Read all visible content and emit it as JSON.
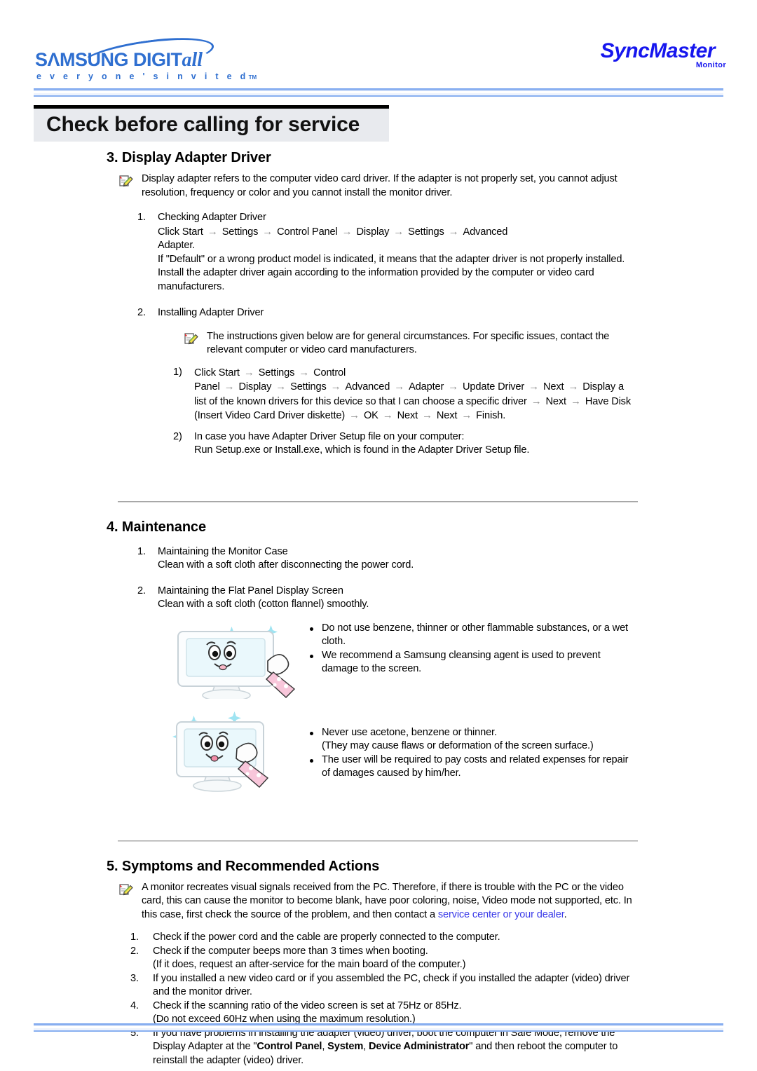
{
  "header": {
    "samsung_logo": {
      "wordmark_main": "SΛMSUNG DIGIT",
      "wordmark_italic": "all",
      "tagline": "e v e r y o n e ' s   i n v i t e d",
      "tagline_tm": "TM"
    },
    "syncmaster_logo": {
      "word": "SyncMaster",
      "sub": "Monitor"
    }
  },
  "title_banner": {
    "title": "Check before calling for service"
  },
  "section3": {
    "heading": "3. Display Adapter Driver",
    "note": "Display adapter refers to the computer video card driver. If the adapter is not properly set, you cannot adjust resolution, frequency or color and you cannot install the monitor driver.",
    "items": [
      {
        "num": "1.",
        "title": "Checking Adapter Driver",
        "path_segments": [
          "Click Start",
          "Settings",
          "Control Panel",
          "Display",
          "Settings",
          "Advanced"
        ],
        "path_tail": "Adapter.",
        "body": "If \"Default\" or a wrong product model is indicated, it means that the adapter driver is not properly installed. Install the adapter driver again according to the information provided by the computer or video card manufacturers."
      },
      {
        "num": "2.",
        "title": "Installing Adapter Driver",
        "note": "The instructions given below are for general circumstances. For specific issues, contact the relevant computer or video card manufacturers.",
        "subitems": [
          {
            "num": "1)",
            "segments": [
              "Click Start",
              "Settings",
              "Control Panel",
              "Display",
              "Settings",
              "Advanced"
            ],
            "segments2": [
              "Adapter",
              "Update Driver",
              "Next",
              "Display a list of the known drivers for this device so that I can choose a specific driver",
              "Next",
              "Have Disk (Insert Video Card Driver diskette)",
              "OK",
              "Next",
              "Next",
              "Finish."
            ]
          },
          {
            "num": "2)",
            "line1": "In case you have Adapter Driver Setup file on your computer:",
            "line2": "Run Setup.exe or Install.exe, which is found in the Adapter Driver Setup file."
          }
        ]
      }
    ]
  },
  "section4": {
    "heading": "4. Maintenance",
    "items": [
      {
        "num": "1.",
        "title": "Maintaining the Monitor Case",
        "body": "Clean with a soft cloth after disconnecting the power cord."
      },
      {
        "num": "2.",
        "title": "Maintaining the Flat Panel Display Screen",
        "body": "Clean with a soft cloth (cotton flannel) smoothly."
      }
    ],
    "illustration1_bullets": [
      "Do not use benzene, thinner or other flammable substances, or a wet cloth.",
      "We recommend a Samsung cleansing agent is used to prevent damage to the screen."
    ],
    "illustration2_bullets": [
      "Never use acetone, benzene or thinner.",
      "(They may cause flaws or deformation of the screen surface.)",
      "The user will be required to pay costs and related expenses for repair of damages caused by him/her."
    ]
  },
  "section5": {
    "heading": "5. Symptoms and Recommended Actions",
    "note_part1": "A monitor recreates visual signals received from the PC. Therefore, if there is trouble with the PC or the video card, this can cause the monitor to become blank, have poor coloring, noise, Video mode not supported, etc. In this case, first check the source of the problem, and then contact a ",
    "note_link": "service center or your dealer",
    "note_part2": ".",
    "items": [
      {
        "num": "1.",
        "text": "Check if the power cord and the cable are properly connected to the computer."
      },
      {
        "num": "2.",
        "text": "Check if the computer beeps more than 3 times when booting.",
        "text2": "(If it does, request an after-service for the main board of the computer.)"
      },
      {
        "num": "3.",
        "text": "If you installed a new video card or if you assembled the PC, check if you installed the adapter (video) driver and the monitor driver."
      },
      {
        "num": "4.",
        "text": "Check if the scanning ratio of the video screen is set at 75Hz or 85Hz.",
        "text2": "(Do not exceed 60Hz when using the maximum resolution.)"
      },
      {
        "num": "5.",
        "text_a": "If you have problems in installing the adapter (video) driver, boot the computer in Safe Mode, remove the Display Adapter at the \"",
        "bold_a": "Control Panel",
        "text_b": ", ",
        "bold_b": "System",
        "text_c": ", ",
        "bold_c": "Device Administrator",
        "text_d": "\" and then reboot the computer to reinstall the adapter (video) driver."
      }
    ]
  },
  "colors": {
    "brand_blue": "#2f6fd0",
    "link_blue": "#3a3ae8",
    "banner_bg": "#e8eaee",
    "rule_blue": "#7da7ef"
  },
  "icons": {
    "note": "note-pencil-icon",
    "monitor_cleaning": "monitor-cleaning-illustration"
  }
}
